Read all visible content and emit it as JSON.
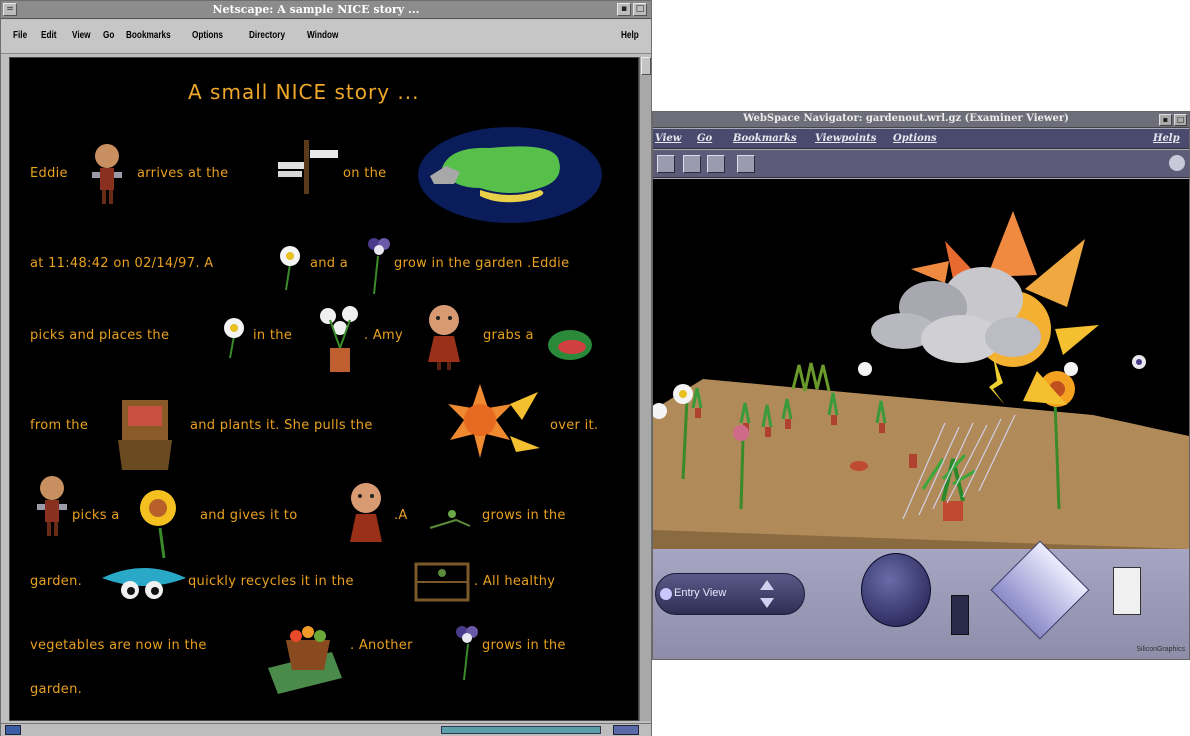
{
  "netscape": {
    "title": "Netscape: A sample NICE story ...",
    "menu": [
      "File",
      "Edit",
      "View",
      "Go",
      "Bookmarks",
      "Options",
      "Directory",
      "Window"
    ],
    "help": "Help",
    "story": {
      "heading": "A small NICE story ...",
      "lines": [
        [
          "Eddie",
          "arrives at the",
          "on the"
        ],
        [
          "at 11:48:42 on 02/14/97. A",
          "and a",
          "grow in the garden .Eddie"
        ],
        [
          "picks and places the",
          "in the",
          ". Amy",
          "grabs a"
        ],
        [
          "from the",
          "and plants it. She pulls the",
          "over it."
        ],
        [
          "picks a",
          "and gives it to",
          ".A",
          "grows in the"
        ],
        [
          "garden.",
          "quickly recycles it in the",
          ". All healthy"
        ],
        [
          "vegetables are now in the",
          ". Another",
          "grows in the"
        ],
        [
          "garden."
        ]
      ]
    }
  },
  "webspace": {
    "title": "WebSpace Navigator: gardenout.wrl.gz (Examiner Viewer)",
    "menu": [
      "View",
      "Go",
      "Bookmarks",
      "Viewpoints",
      "Options"
    ],
    "help": "Help",
    "viewpoint": "Entry View",
    "brand": "SiliconGraphics"
  },
  "colors": {
    "story_text": "#e8a020",
    "netscape_bg": "#000000",
    "ground": "#b08a58",
    "dashboard": "#a0a0bc"
  }
}
